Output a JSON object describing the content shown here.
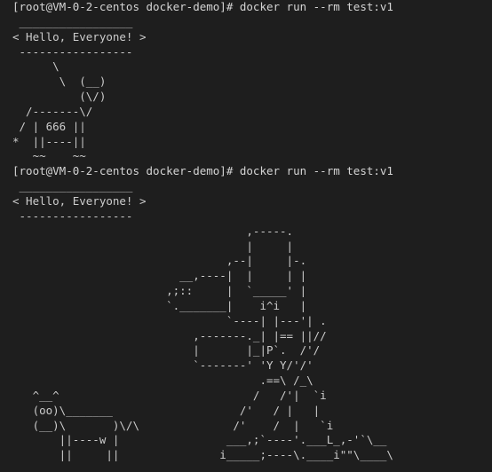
{
  "terminal": {
    "lines": [
      "[root@VM-0-2-centos docker-demo]# docker run --rm test:v1",
      " _________________",
      "< Hello, Everyone! >",
      " -----------------",
      "      \\",
      "       \\  (__)",
      "          (\\/)",
      "  /-------\\/",
      " / | 666 ||",
      "*  ||----||",
      "   ~~    ~~",
      "[root@VM-0-2-centos docker-demo]# docker run --rm test:v1",
      " _________________",
      "< Hello, Everyone! >",
      " -----------------",
      "                                   ,-----.",
      "                                   |     |",
      "                                ,--|     |-.",
      "                         __,----|  |     | |",
      "                       ,;::     |  `_____' |",
      "                       `._______|    i^i   |",
      "                                `----| |---'| .",
      "                           ,-------._| |== ||//",
      "                           |       |_|P`.  /'/",
      "                           `-------' 'Y Y/'/'",
      "                                     .==\\ /_\\",
      "   ^__^                             /   /'|  `i",
      "   (oo)\\_______                   /'   / |   |",
      "   (__)\\       )\\/\\              /'    /  |   `i",
      "       ||----w |                ___,;`----'.___L_,-'`\\__",
      "       ||     ||               i_____;----\\.____i\"\"\\____\\"
    ]
  }
}
